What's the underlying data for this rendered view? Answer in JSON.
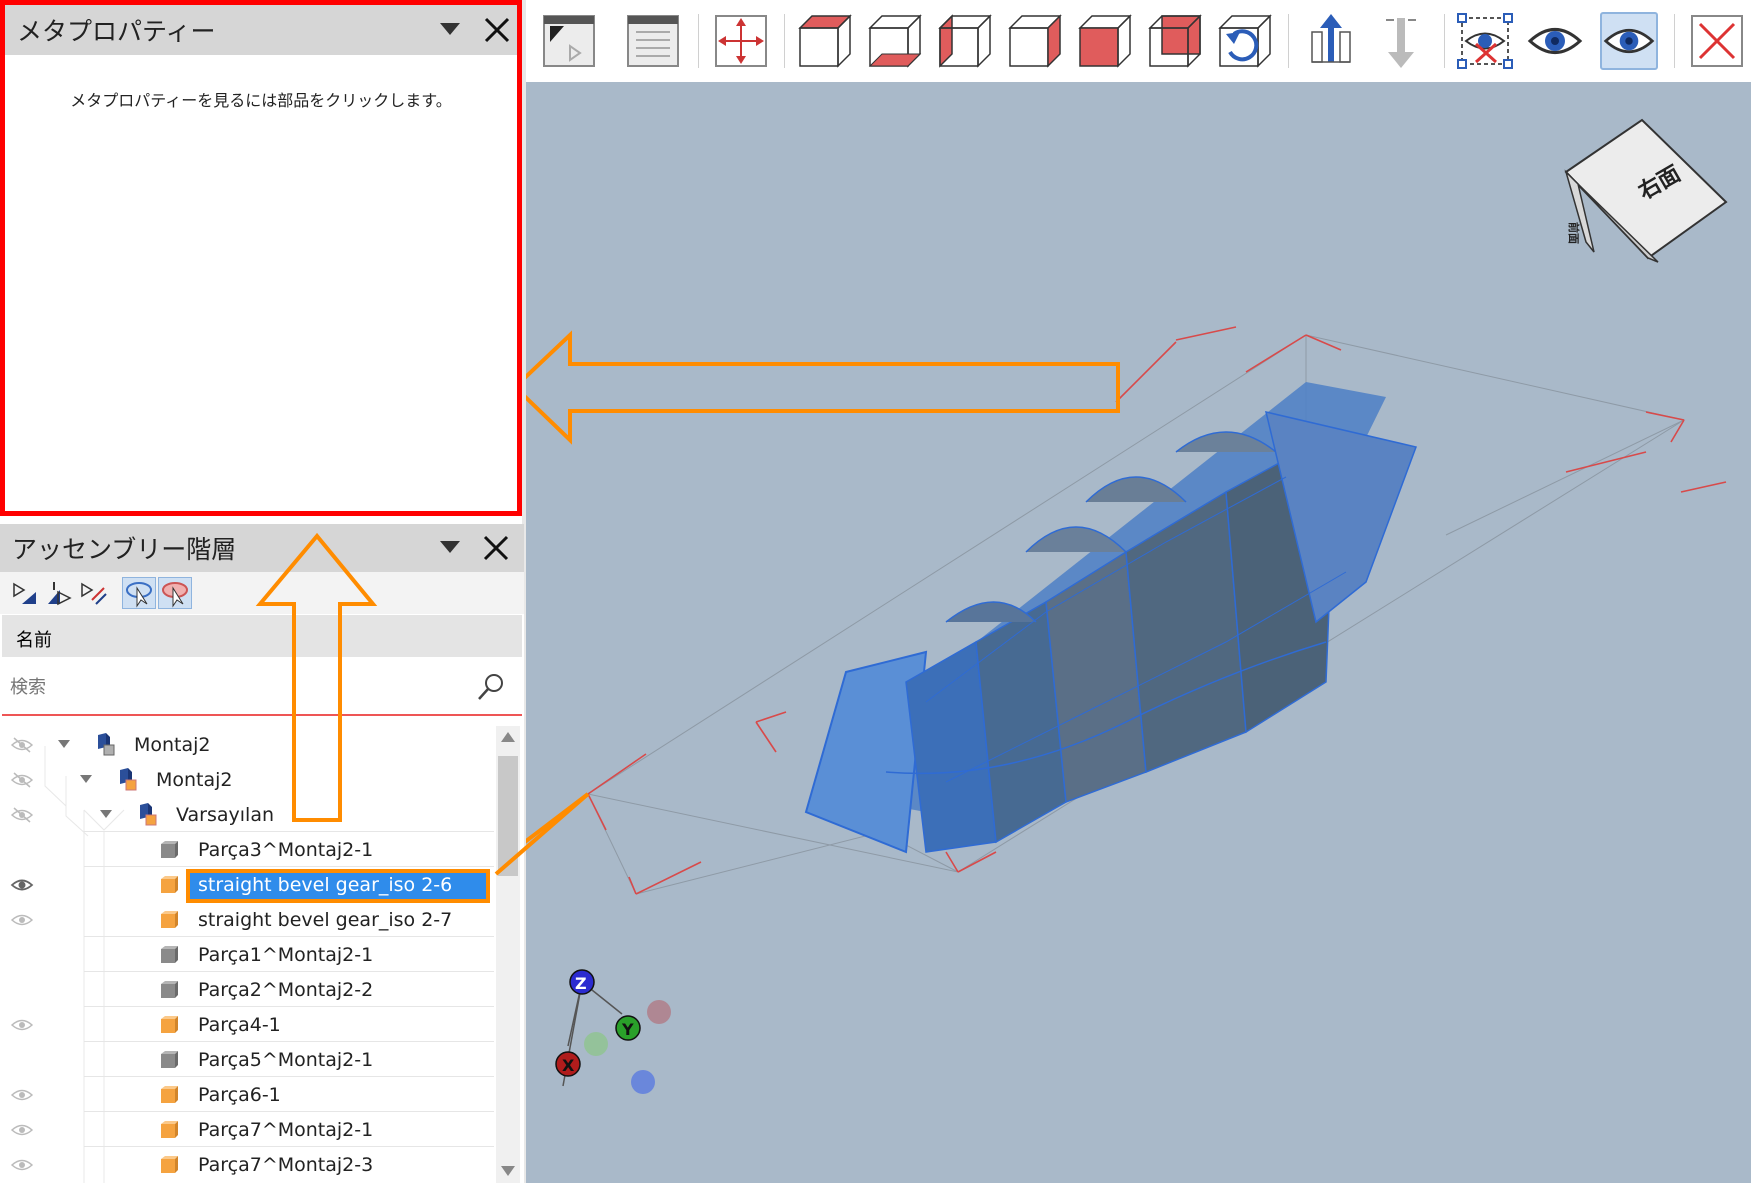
{
  "meta_panel": {
    "title": "メタプロパティー",
    "message": "メタプロパティーを見るには部品をクリックします。"
  },
  "tree_panel": {
    "title": "アッセンブリー階層",
    "column_name": "名前",
    "search_placeholder": "検索",
    "items": [
      {
        "label": "Montaj2"
      },
      {
        "label": "Montaj2"
      },
      {
        "label": "Varsayılan"
      },
      {
        "label": "Parça3^Montaj2-1"
      },
      {
        "label": "straight bevel gear_iso 2-6"
      },
      {
        "label": "straight bevel gear_iso 2-7"
      },
      {
        "label": "Parça1^Montaj2-1"
      },
      {
        "label": "Parça2^Montaj2-2"
      },
      {
        "label": "Parça4-1"
      },
      {
        "label": "Parça5^Montaj2-1"
      },
      {
        "label": "Parça6-1"
      },
      {
        "label": "Parça7^Montaj2-1"
      },
      {
        "label": "Parça7^Montaj2-3"
      }
    ]
  },
  "viewcube": {
    "face_label": "右面",
    "side_label": "前面"
  },
  "triad": {
    "x": "X",
    "y": "Y",
    "z": "Z"
  },
  "colors": {
    "highlight_border": "#ff0000",
    "annotation_orange": "#ff8c00",
    "selection_blue": "#2f8ceb",
    "viewport_bg": "#a9b9c9",
    "part_blue": "#4a7fc8"
  }
}
